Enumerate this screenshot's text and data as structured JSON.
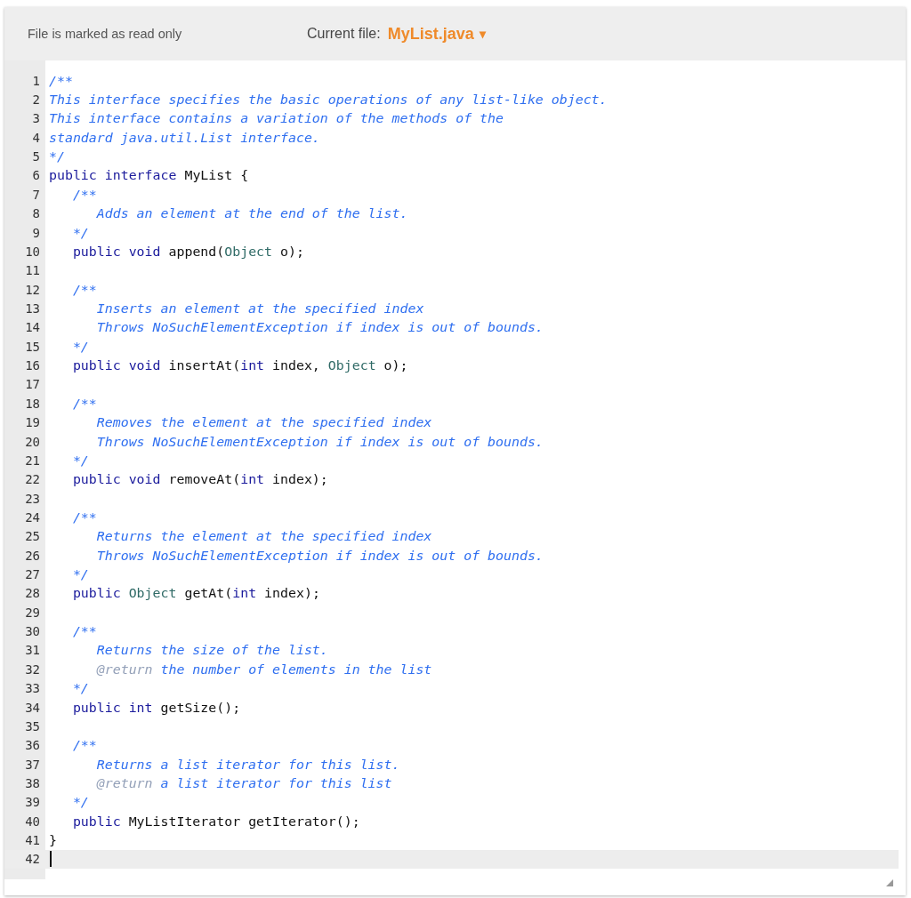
{
  "header": {
    "status": "File is marked as read only",
    "file_label": "Current file:",
    "file_name": "MyList.java",
    "dropdown_caret": "▾"
  },
  "editor": {
    "lines": [
      {
        "number": "1",
        "current": false,
        "tokens": [
          {
            "kind": "comment",
            "text": "/**"
          }
        ]
      },
      {
        "number": "2",
        "current": false,
        "tokens": [
          {
            "kind": "comment",
            "text": "This interface specifies the basic operations of any list-like object."
          }
        ]
      },
      {
        "number": "3",
        "current": false,
        "tokens": [
          {
            "kind": "comment",
            "text": "This interface contains a variation of the methods of the"
          }
        ]
      },
      {
        "number": "4",
        "current": false,
        "tokens": [
          {
            "kind": "comment",
            "text": "standard java.util.List interface."
          }
        ]
      },
      {
        "number": "5",
        "current": false,
        "tokens": [
          {
            "kind": "comment",
            "text": "*/"
          }
        ]
      },
      {
        "number": "6",
        "current": false,
        "tokens": [
          {
            "kind": "keyword",
            "text": "public interface"
          },
          {
            "kind": "plain",
            "text": " MyList {"
          }
        ]
      },
      {
        "number": "7",
        "current": false,
        "tokens": [
          {
            "kind": "comment",
            "text": "   /**"
          }
        ]
      },
      {
        "number": "8",
        "current": false,
        "tokens": [
          {
            "kind": "comment",
            "text": "      Adds an element at the end of the list."
          }
        ]
      },
      {
        "number": "9",
        "current": false,
        "tokens": [
          {
            "kind": "comment",
            "text": "   */"
          }
        ]
      },
      {
        "number": "10",
        "current": false,
        "tokens": [
          {
            "kind": "keyword",
            "text": "   public void"
          },
          {
            "kind": "plain",
            "text": " append("
          },
          {
            "kind": "type",
            "text": "Object"
          },
          {
            "kind": "plain",
            "text": " o);"
          }
        ]
      },
      {
        "number": "11",
        "current": false
      },
      {
        "number": "12",
        "current": false,
        "tokens": [
          {
            "kind": "comment",
            "text": "   /**"
          }
        ]
      },
      {
        "number": "13",
        "current": false,
        "tokens": [
          {
            "kind": "comment",
            "text": "      Inserts an element at the specified index"
          }
        ]
      },
      {
        "number": "14",
        "current": false,
        "tokens": [
          {
            "kind": "comment",
            "text": "      Throws NoSuchElementException if index is out of bounds."
          }
        ]
      },
      {
        "number": "15",
        "current": false,
        "tokens": [
          {
            "kind": "comment",
            "text": "   */"
          }
        ]
      },
      {
        "number": "16",
        "current": false,
        "tokens": [
          {
            "kind": "keyword",
            "text": "   public void"
          },
          {
            "kind": "plain",
            "text": " insertAt("
          },
          {
            "kind": "keyword",
            "text": "int"
          },
          {
            "kind": "plain",
            "text": " index, "
          },
          {
            "kind": "type",
            "text": "Object"
          },
          {
            "kind": "plain",
            "text": " o);"
          }
        ]
      },
      {
        "number": "17",
        "current": false
      },
      {
        "number": "18",
        "current": false,
        "tokens": [
          {
            "kind": "comment",
            "text": "   /**"
          }
        ]
      },
      {
        "number": "19",
        "current": false,
        "tokens": [
          {
            "kind": "comment",
            "text": "      Removes the element at the specified index"
          }
        ]
      },
      {
        "number": "20",
        "current": false,
        "tokens": [
          {
            "kind": "comment",
            "text": "      Throws NoSuchElementException if index is out of bounds."
          }
        ]
      },
      {
        "number": "21",
        "current": false,
        "tokens": [
          {
            "kind": "comment",
            "text": "   */"
          }
        ]
      },
      {
        "number": "22",
        "current": false,
        "tokens": [
          {
            "kind": "keyword",
            "text": "   public void"
          },
          {
            "kind": "plain",
            "text": " removeAt("
          },
          {
            "kind": "keyword",
            "text": "int"
          },
          {
            "kind": "plain",
            "text": " index);"
          }
        ]
      },
      {
        "number": "23",
        "current": false
      },
      {
        "number": "24",
        "current": false,
        "tokens": [
          {
            "kind": "comment",
            "text": "   /**"
          }
        ]
      },
      {
        "number": "25",
        "current": false,
        "tokens": [
          {
            "kind": "comment",
            "text": "      Returns the element at the specified index"
          }
        ]
      },
      {
        "number": "26",
        "current": false,
        "tokens": [
          {
            "kind": "comment",
            "text": "      Throws NoSuchElementException if index is out of bounds."
          }
        ]
      },
      {
        "number": "27",
        "current": false,
        "tokens": [
          {
            "kind": "comment",
            "text": "   */"
          }
        ]
      },
      {
        "number": "28",
        "current": false,
        "tokens": [
          {
            "kind": "keyword",
            "text": "   public"
          },
          {
            "kind": "type",
            "text": " Object"
          },
          {
            "kind": "plain",
            "text": " getAt("
          },
          {
            "kind": "keyword",
            "text": "int"
          },
          {
            "kind": "plain",
            "text": " index);"
          }
        ]
      },
      {
        "number": "29",
        "current": false
      },
      {
        "number": "30",
        "current": false,
        "tokens": [
          {
            "kind": "comment",
            "text": "   /**"
          }
        ]
      },
      {
        "number": "31",
        "current": false,
        "tokens": [
          {
            "kind": "comment",
            "text": "      Returns the size of the list."
          }
        ]
      },
      {
        "number": "32",
        "current": false,
        "tokens": [
          {
            "kind": "tag",
            "text": "      @return"
          },
          {
            "kind": "comment",
            "text": " the number of elements in the list"
          }
        ]
      },
      {
        "number": "33",
        "current": false,
        "tokens": [
          {
            "kind": "comment",
            "text": "   */"
          }
        ]
      },
      {
        "number": "34",
        "current": false,
        "tokens": [
          {
            "kind": "keyword",
            "text": "   public int"
          },
          {
            "kind": "plain",
            "text": " getSize();"
          }
        ]
      },
      {
        "number": "35",
        "current": false
      },
      {
        "number": "36",
        "current": false,
        "tokens": [
          {
            "kind": "comment",
            "text": "   /**"
          }
        ]
      },
      {
        "number": "37",
        "current": false,
        "tokens": [
          {
            "kind": "comment",
            "text": "      Returns a list iterator for this list."
          }
        ]
      },
      {
        "number": "38",
        "current": false,
        "tokens": [
          {
            "kind": "tag",
            "text": "      @return"
          },
          {
            "kind": "comment",
            "text": " a list iterator for this list"
          }
        ]
      },
      {
        "number": "39",
        "current": false,
        "tokens": [
          {
            "kind": "comment",
            "text": "   */"
          }
        ]
      },
      {
        "number": "40",
        "current": false,
        "tokens": [
          {
            "kind": "keyword",
            "text": "   public"
          },
          {
            "kind": "plain",
            "text": " MyListIterator getIterator();"
          }
        ]
      },
      {
        "number": "41",
        "current": false,
        "tokens": [
          {
            "kind": "plain",
            "text": "}"
          }
        ]
      },
      {
        "number": "42",
        "current": true
      }
    ]
  }
}
